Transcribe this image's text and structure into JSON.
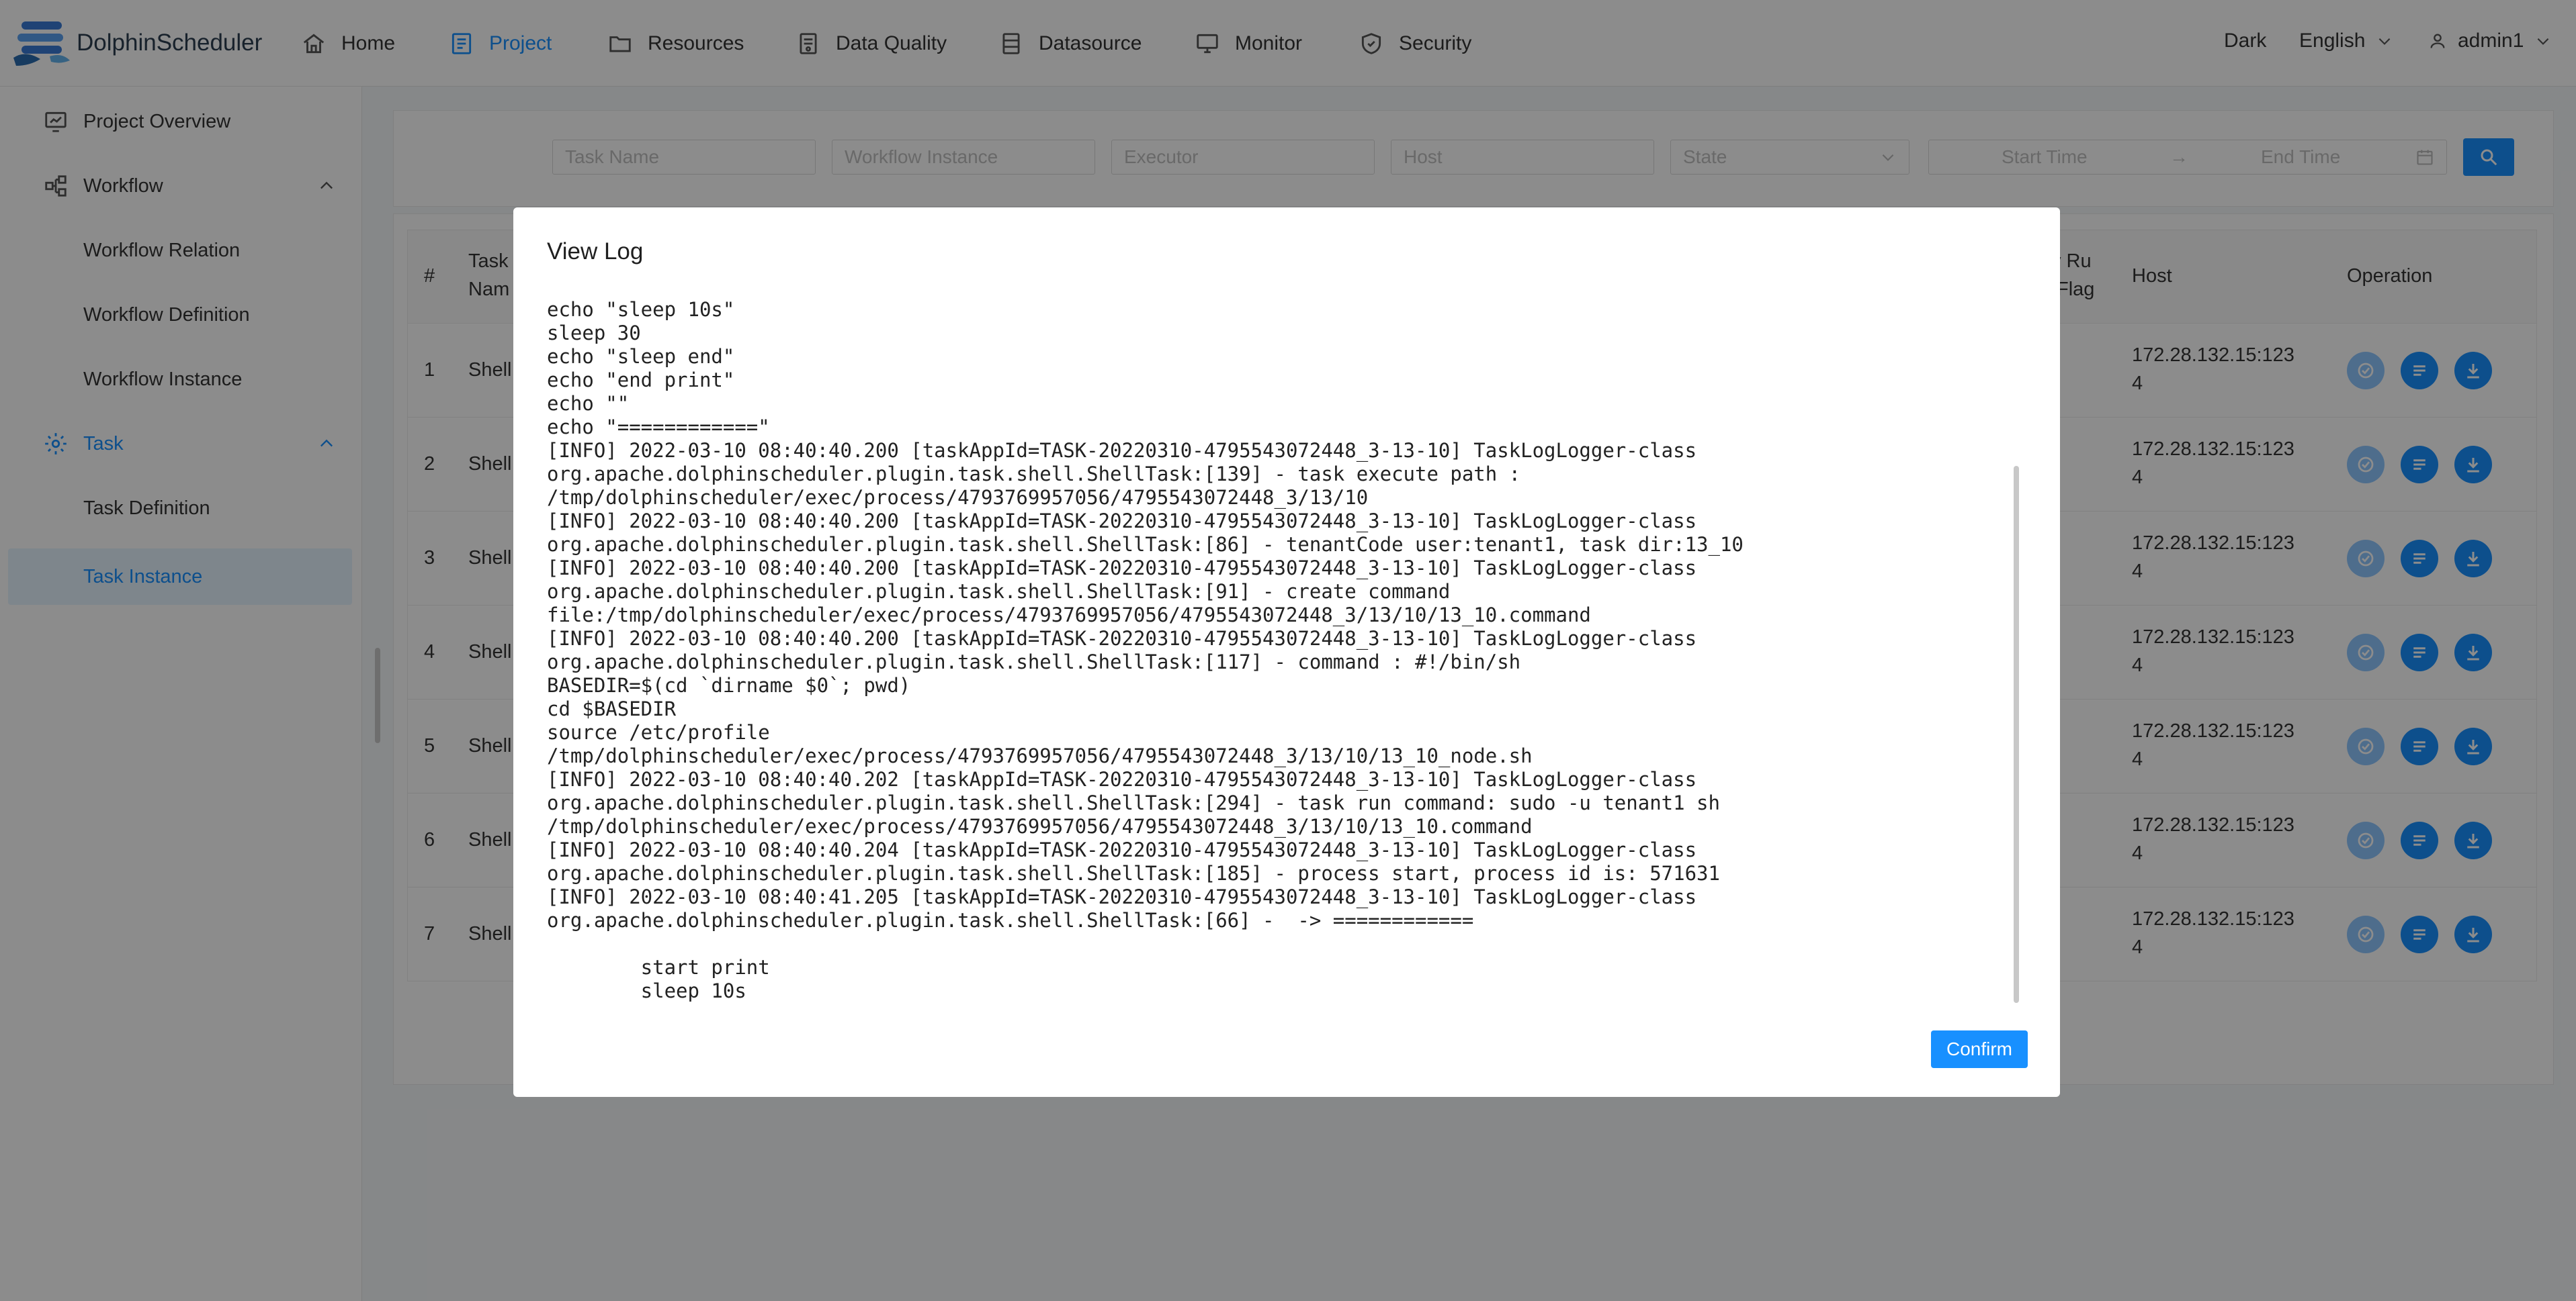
{
  "app": {
    "brand": "DolphinScheduler"
  },
  "nav": {
    "items": [
      {
        "label": "Home",
        "icon": "home-icon"
      },
      {
        "label": "Project",
        "icon": "project-icon",
        "active": true
      },
      {
        "label": "Resources",
        "icon": "folder-icon"
      },
      {
        "label": "Data Quality",
        "icon": "data-quality-icon"
      },
      {
        "label": "Datasource",
        "icon": "datasource-icon"
      },
      {
        "label": "Monitor",
        "icon": "monitor-icon"
      },
      {
        "label": "Security",
        "icon": "shield-icon"
      }
    ],
    "theme": "Dark",
    "language": "English",
    "user": "admin1"
  },
  "sidebar": {
    "items": [
      {
        "label": "Project Overview"
      },
      {
        "label": "Workflow"
      },
      {
        "label": "Workflow Relation"
      },
      {
        "label": "Workflow Definition"
      },
      {
        "label": "Workflow Instance"
      },
      {
        "label": "Task"
      },
      {
        "label": "Task Definition"
      },
      {
        "label": "Task Instance",
        "selected": true
      }
    ]
  },
  "filters": {
    "task_name": "Task Name",
    "workflow_instance": "Workflow Instance",
    "executor": "Executor",
    "host": "Host",
    "state": "State",
    "start_time": "Start Time",
    "arrow": "→",
    "end_time": "End Time"
  },
  "table": {
    "headers": {
      "index": "#",
      "task_name_line1": "Task",
      "task_name_line2": "Nam",
      "dry_run_line1": "y Ru",
      "dry_run_line2": "Flag",
      "host": "Host",
      "operation": "Operation"
    },
    "rows": [
      {
        "index": "1",
        "name": "Shell",
        "host_line1": "172.28.132.15:123",
        "host_line2": "4"
      },
      {
        "index": "2",
        "name": "Shell",
        "host_line1": "172.28.132.15:123",
        "host_line2": "4"
      },
      {
        "index": "3",
        "name": "Shell",
        "host_line1": "172.28.132.15:123",
        "host_line2": "4"
      },
      {
        "index": "4",
        "name": "Shell",
        "host_line1": "172.28.132.15:123",
        "host_line2": "4"
      },
      {
        "index": "5",
        "name": "Shell",
        "host_line1": "172.28.132.15:123",
        "host_line2": "4"
      },
      {
        "index": "6",
        "name": "Shell",
        "host_line1": "172.28.132.15:123",
        "host_line2": "4"
      },
      {
        "index": "7",
        "name": "Shell",
        "host_line1": "172.28.132.15:123",
        "host_line2": "4"
      }
    ]
  },
  "modal": {
    "title": "View Log",
    "log": "echo \"sleep 10s\"\nsleep 30\necho \"sleep end\"\necho \"end print\"\necho \"\"\necho \"============\"\n[INFO] 2022-03-10 08:40:40.200 [taskAppId=TASK-20220310-4795543072448_3-13-10] TaskLogLogger-class\norg.apache.dolphinscheduler.plugin.task.shell.ShellTask:[139] - task execute path :\n/tmp/dolphinscheduler/exec/process/4793769957056/4795543072448_3/13/10\n[INFO] 2022-03-10 08:40:40.200 [taskAppId=TASK-20220310-4795543072448_3-13-10] TaskLogLogger-class\norg.apache.dolphinscheduler.plugin.task.shell.ShellTask:[86] - tenantCode user:tenant1, task dir:13_10\n[INFO] 2022-03-10 08:40:40.200 [taskAppId=TASK-20220310-4795543072448_3-13-10] TaskLogLogger-class\norg.apache.dolphinscheduler.plugin.task.shell.ShellTask:[91] - create command\nfile:/tmp/dolphinscheduler/exec/process/4793769957056/4795543072448_3/13/10/13_10.command\n[INFO] 2022-03-10 08:40:40.200 [taskAppId=TASK-20220310-4795543072448_3-13-10] TaskLogLogger-class\norg.apache.dolphinscheduler.plugin.task.shell.ShellTask:[117] - command : #!/bin/sh\nBASEDIR=$(cd `dirname $0`; pwd)\ncd $BASEDIR\nsource /etc/profile\n/tmp/dolphinscheduler/exec/process/4793769957056/4795543072448_3/13/10/13_10_node.sh\n[INFO] 2022-03-10 08:40:40.202 [taskAppId=TASK-20220310-4795543072448_3-13-10] TaskLogLogger-class\norg.apache.dolphinscheduler.plugin.task.shell.ShellTask:[294] - task run command: sudo -u tenant1 sh\n/tmp/dolphinscheduler/exec/process/4793769957056/4795543072448_3/13/10/13_10.command\n[INFO] 2022-03-10 08:40:40.204 [taskAppId=TASK-20220310-4795543072448_3-13-10] TaskLogLogger-class\norg.apache.dolphinscheduler.plugin.task.shell.ShellTask:[185] - process start, process id is: 571631\n[INFO] 2022-03-10 08:40:41.205 [taskAppId=TASK-20220310-4795543072448_3-13-10] TaskLogLogger-class\norg.apache.dolphinscheduler.plugin.task.shell.ShellTask:[66] -  -> ============\n\n        start print\n        sleep 10s",
    "confirm": "Confirm"
  },
  "colors": {
    "accent": "#1890ff",
    "accent_light": "#8fc7ff",
    "mask": "rgba(0,0,0,0.45)"
  }
}
